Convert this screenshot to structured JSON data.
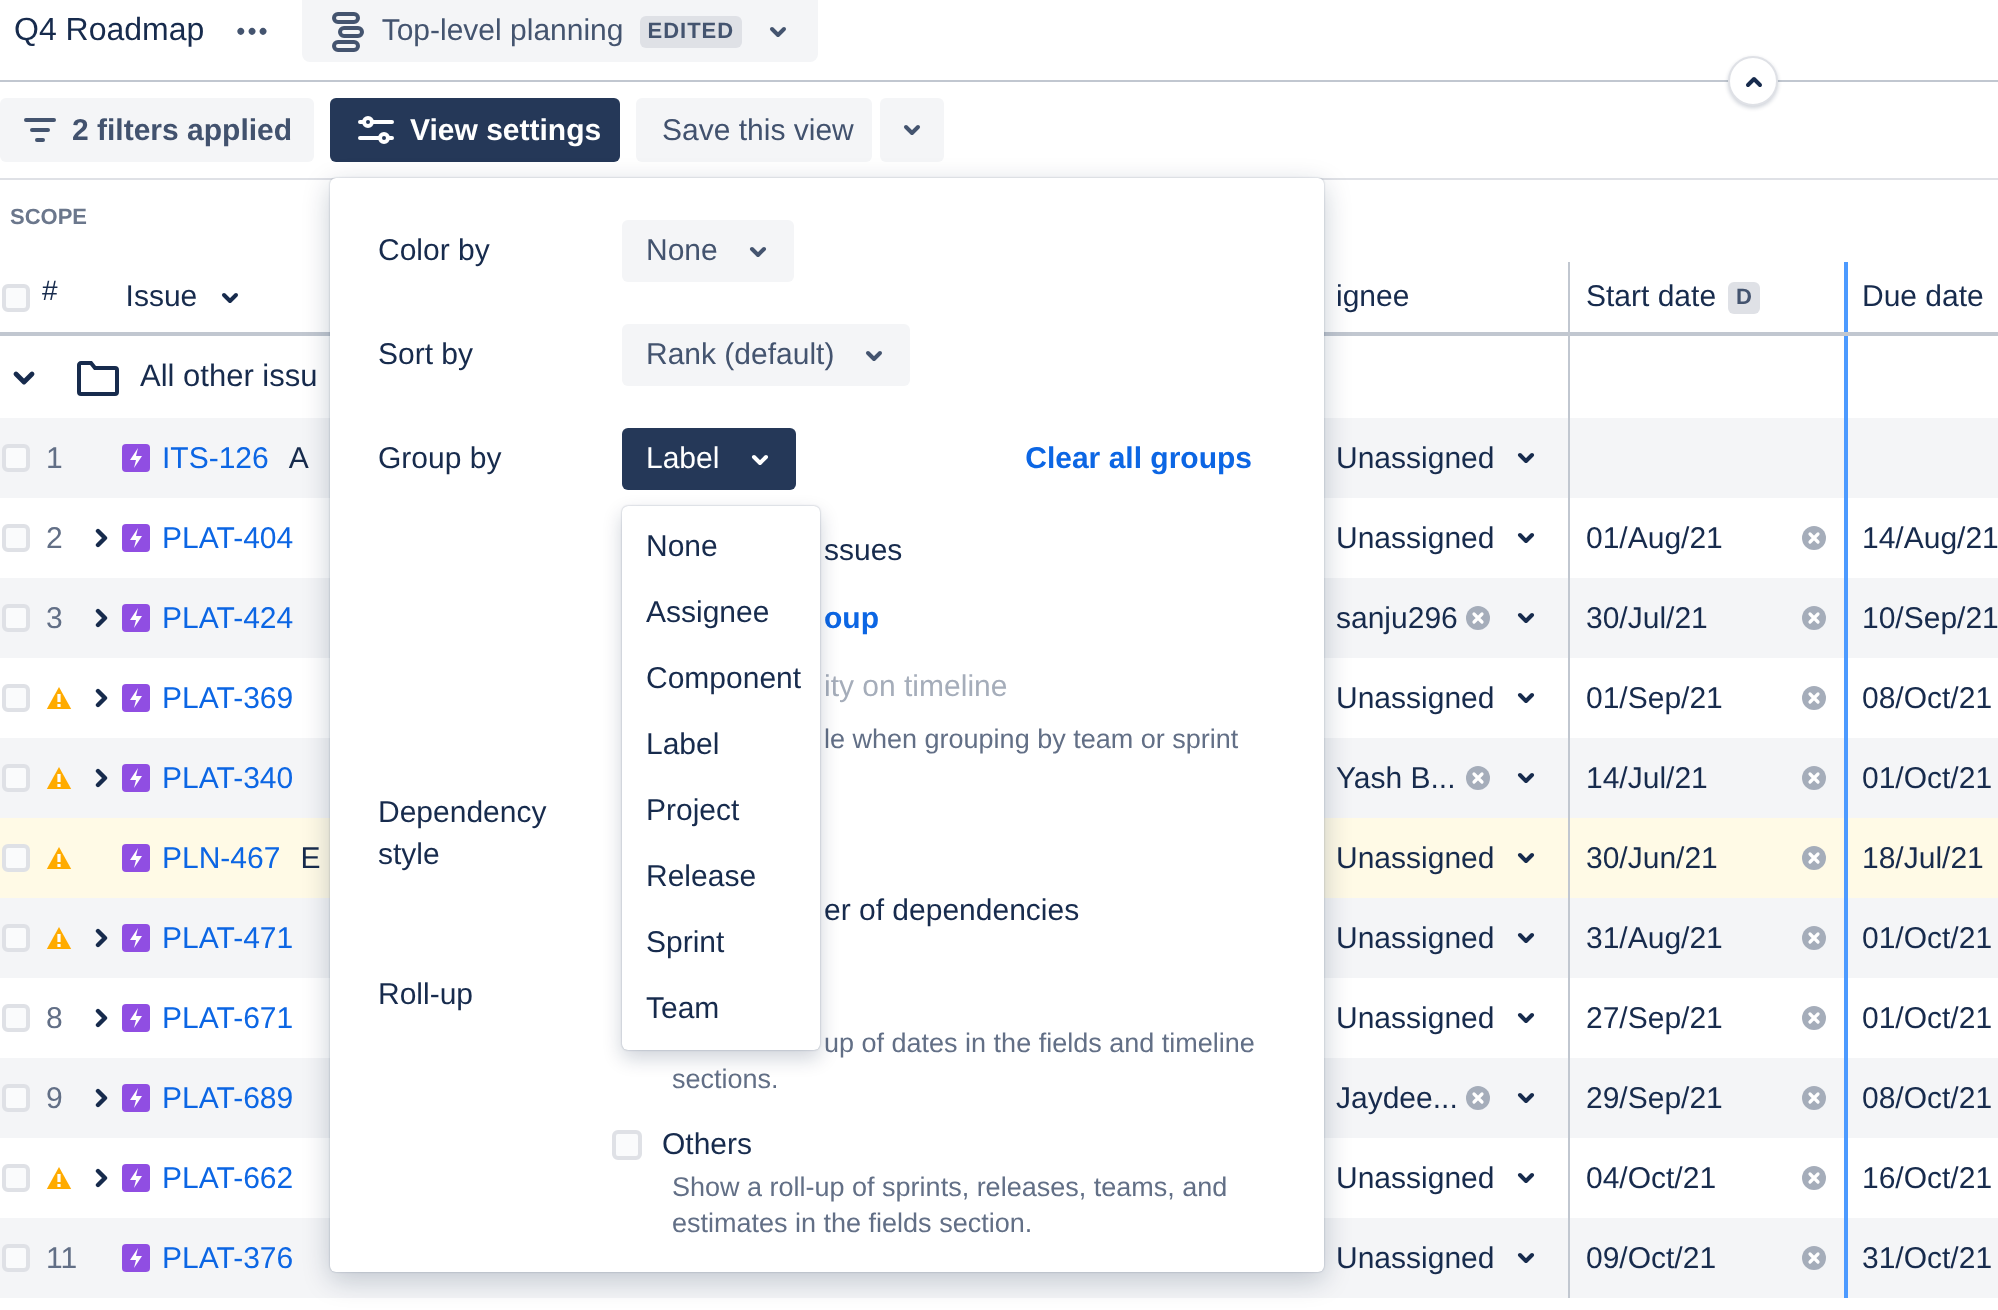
{
  "header": {
    "title": "Q4 Roadmap",
    "more": "•••",
    "view": {
      "name": "Top-level planning",
      "badge": "EDITED"
    }
  },
  "toolbar": {
    "filters": "2 filters applied",
    "view_settings": "View settings",
    "save_view": "Save this view"
  },
  "scope": {
    "label": "SCOPE",
    "columns": {
      "select_all_checked": false,
      "number": "#",
      "issue": "Issue",
      "assignee": "ignee",
      "start": "Start date",
      "start_badge": "D",
      "due": "Due date"
    },
    "group": {
      "title": "All other issu"
    },
    "rows": [
      {
        "number": "1",
        "warning": false,
        "expandable": false,
        "key": "ITS-126",
        "summary": "A",
        "assignee": "Unassigned",
        "assignee_clearable": false,
        "highlighted": false
      },
      {
        "number": "2",
        "warning": false,
        "expandable": true,
        "key": "PLAT-404",
        "assignee": "Unassigned",
        "assignee_clearable": false,
        "start": "01/Aug/21",
        "due": "14/Aug/21",
        "highlighted": false
      },
      {
        "number": "3",
        "warning": false,
        "expandable": true,
        "key": "PLAT-424",
        "assignee": "sanju296",
        "assignee_clearable": true,
        "start": "30/Jul/21",
        "due": "10/Sep/21",
        "highlighted": false
      },
      {
        "warning": true,
        "expandable": true,
        "key": "PLAT-369",
        "assignee": "Unassigned",
        "assignee_clearable": false,
        "start": "01/Sep/21",
        "due": "08/Oct/21",
        "highlighted": false
      },
      {
        "warning": true,
        "expandable": true,
        "key": "PLAT-340",
        "assignee": "Yash B...",
        "assignee_clearable": true,
        "start": "14/Jul/21",
        "due": "01/Oct/21",
        "highlighted": false
      },
      {
        "warning": true,
        "expandable": false,
        "key": "PLN-467",
        "summary": "E",
        "assignee": "Unassigned",
        "assignee_clearable": false,
        "start": "30/Jun/21",
        "due": "18/Jul/21",
        "highlighted": true
      },
      {
        "warning": true,
        "expandable": true,
        "key": "PLAT-471",
        "assignee": "Unassigned",
        "assignee_clearable": false,
        "start": "31/Aug/21",
        "due": "01/Oct/21",
        "highlighted": false
      },
      {
        "number": "8",
        "warning": false,
        "expandable": true,
        "key": "PLAT-671",
        "assignee": "Unassigned",
        "assignee_clearable": false,
        "start": "27/Sep/21",
        "due": "01/Oct/21",
        "highlighted": false
      },
      {
        "number": "9",
        "warning": false,
        "expandable": true,
        "key": "PLAT-689",
        "assignee": "Jaydee...",
        "assignee_clearable": true,
        "start": "29/Sep/21",
        "due": "08/Oct/21",
        "highlighted": false
      },
      {
        "warning": true,
        "expandable": true,
        "key": "PLAT-662",
        "assignee": "Unassigned",
        "assignee_clearable": false,
        "start": "04/Oct/21",
        "due": "16/Oct/21",
        "highlighted": false
      },
      {
        "number": "11",
        "warning": false,
        "expandable": false,
        "key": "PLAT-376",
        "assignee": "Unassigned",
        "assignee_clearable": false,
        "start": "09/Oct/21",
        "due": "31/Oct/21",
        "highlighted": false
      }
    ]
  },
  "view_settings_panel": {
    "color_by": {
      "label": "Color by",
      "value": "None"
    },
    "sort_by": {
      "label": "Sort by",
      "value": "Rank (default)"
    },
    "group_by": {
      "label": "Group by",
      "value": "Label",
      "clear": "Clear all groups",
      "options": [
        "None",
        "Assignee",
        "Component",
        "Label",
        "Project",
        "Release",
        "Sprint",
        "Team"
      ],
      "fragments": [
        {
          "kind": "text",
          "text": "ssues"
        },
        {
          "kind": "link",
          "text": "oup"
        },
        {
          "kind": "disabled",
          "text": "ity on timeline"
        },
        {
          "kind": "hint",
          "text": "le when grouping by team or sprint"
        }
      ]
    },
    "dependency_style": {
      "label": "Dependency style",
      "fragment": "er of dependencies"
    },
    "roll_up": {
      "label": "Roll-up",
      "hint_fragment": "up of dates in the fields and timeline",
      "hint_tail": "sections.",
      "others": {
        "label": "Others",
        "checked": false,
        "description": "Show a roll-up of sprints, releases, teams, and estimates in the fields section."
      }
    }
  }
}
